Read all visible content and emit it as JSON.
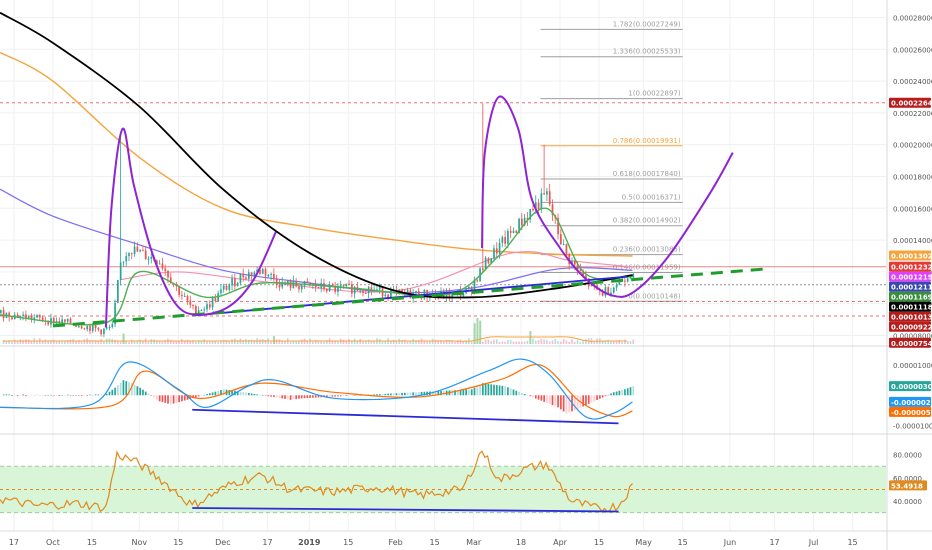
{
  "chart_data": {
    "type": "line",
    "colors": {
      "up": "#26a69a",
      "down": "#ef5350",
      "black_ma": "#000000",
      "orange_ma": "#f4a43c",
      "blue_ma": "#7b6ef6",
      "green_ma": "#4caf50",
      "pink_ma": "#f48fb1",
      "pattern": "#8e24d4",
      "trend": "#2a2ad8",
      "dashed_trend": "#1f9d2c",
      "rsi": "#e08a1e",
      "rsi_band": "#d9f5d8",
      "macd_line": "#2196f3",
      "signal_line": "#ff6d00",
      "level_red": "#e53935",
      "fib": "#9e9e9e",
      "fib_orange": "#f4a43c"
    },
    "x_axis": {
      "range": [
        "2018-09-12",
        "2019-07-27"
      ],
      "ticks": [
        {
          "label": "17",
          "date": "2018-09-17"
        },
        {
          "label": "Oct",
          "date": "2018-10-01"
        },
        {
          "label": "15",
          "date": "2018-10-15"
        },
        {
          "label": "Nov",
          "date": "2018-11-01"
        },
        {
          "label": "15",
          "date": "2018-11-15"
        },
        {
          "label": "Dec",
          "date": "2018-12-01"
        },
        {
          "label": "17",
          "date": "2018-12-17"
        },
        {
          "label": "2019",
          "date": "2019-01-01"
        },
        {
          "label": "15",
          "date": "2019-01-15"
        },
        {
          "label": "Feb",
          "date": "2019-02-01"
        },
        {
          "label": "15",
          "date": "2019-02-15"
        },
        {
          "label": "Mar",
          "date": "2019-03-01"
        },
        {
          "label": "18",
          "date": "2019-03-18"
        },
        {
          "label": "Apr",
          "date": "2019-04-01"
        },
        {
          "label": "15",
          "date": "2019-04-15"
        },
        {
          "label": "May",
          "date": "2019-05-01"
        },
        {
          "label": "15",
          "date": "2019-05-15"
        },
        {
          "label": "Jun",
          "date": "2019-06-01"
        },
        {
          "label": "17",
          "date": "2019-06-17"
        },
        {
          "label": "Jul",
          "date": "2019-07-01"
        },
        {
          "label": "15",
          "date": "2019-07-15"
        }
      ]
    },
    "price_pane": {
      "ylim": [
        7.4e-05,
        0.000291
      ],
      "y_ticks": [
        "0.00028000",
        "0.00026000",
        "0.00024000",
        "0.00022000",
        "0.00020000",
        "0.00018000",
        "0.00016000",
        "0.00014000",
        "0.00012000",
        "0.00010000",
        "0.00008000"
      ],
      "tick_values": [
        0.00028,
        0.00026,
        0.00024,
        0.00022,
        0.0002,
        0.00018,
        0.00016,
        0.00014,
        0.00012,
        0.0001,
        8e-05
      ],
      "badges": [
        {
          "text": "0.00022641",
          "bg": "#b71c1c",
          "value": 0.00022641
        },
        {
          "text": "0.00013029",
          "bg": "#f4a43c",
          "value": 0.00013029
        },
        {
          "text": "0.00012324",
          "bg": "#e53935",
          "value": 0.00012324
        },
        {
          "text": "0.00012198",
          "bg": "#e040fb",
          "value": 0.00012198
        },
        {
          "text": "0.00012113",
          "bg": "#3949ab",
          "value": 0.00012113
        },
        {
          "text": "0.00011693",
          "bg": "#388e3c",
          "value": 0.00011693
        },
        {
          "text": "0.00011188",
          "bg": "#000000",
          "value": 0.00011188
        },
        {
          "text": "0.00010136",
          "bg": "#b71c1c",
          "value": 0.00010136
        },
        {
          "text": "0.00009225",
          "bg": "#b71c1c",
          "value": 9.225e-05
        },
        {
          "text": "0.00007541",
          "bg": "#b71c1c",
          "value": 7.541e-05
        }
      ],
      "fib_levels": [
        {
          "label": "1.782(0.00027249)",
          "value": 0.00027249
        },
        {
          "label": "1.336(0.00025533)",
          "value": 0.00025533
        },
        {
          "label": "1(0.00022897)",
          "value": 0.00022897
        },
        {
          "label": "0.786(0.00019931)",
          "value": 0.00019931
        },
        {
          "label": "0.618(0.00017840)",
          "value": 0.0001784
        },
        {
          "label": "0.5(0.00016371)",
          "value": 0.00016371
        },
        {
          "label": "0.382(0.00014902)",
          "value": 0.00014902
        },
        {
          "label": "0.236(0.00013085)",
          "value": 0.00013085
        },
        {
          "label": "0.146(0.00011959)",
          "value": 0.00011959
        },
        {
          "label": "0(0.00010148)",
          "value": 0.00010148
        }
      ],
      "fib_range": [
        "2019-03-25",
        "2019-05-15"
      ],
      "red_dashed_levels": [
        0.00022641,
        0.00010136,
        9.225e-05
      ],
      "red_level": 0.00012324,
      "price_points": [
        [
          "2018-09-12",
          9.4e-05
        ],
        [
          "2018-09-20",
          9.2e-05
        ],
        [
          "2018-10-01",
          8.9e-05
        ],
        [
          "2018-10-10",
          8.7e-05
        ],
        [
          "2018-10-18",
          8.3e-05
        ],
        [
          "2018-10-22",
          8.5e-05
        ],
        [
          "2018-10-25",
          0.000125
        ],
        [
          "2018-10-28",
          0.000135
        ],
        [
          "2018-11-02",
          0.000131
        ],
        [
          "2018-11-08",
          0.000127
        ],
        [
          "2018-11-14",
          0.00011
        ],
        [
          "2018-11-20",
          9.6e-05
        ],
        [
          "2018-11-25",
          9.8e-05
        ],
        [
          "2018-12-01",
          0.000109
        ],
        [
          "2018-12-08",
          0.000118
        ],
        [
          "2018-12-15",
          0.000121
        ],
        [
          "2018-12-22",
          0.000112
        ],
        [
          "2019-01-01",
          0.000111
        ],
        [
          "2019-01-10",
          0.000109
        ],
        [
          "2019-01-20",
          0.00011
        ],
        [
          "2019-02-01",
          0.000106
        ],
        [
          "2019-02-10",
          0.000106
        ],
        [
          "2019-02-20",
          0.000105
        ],
        [
          "2019-02-27",
          0.000108
        ],
        [
          "2019-03-02",
          0.000117
        ],
        [
          "2019-03-06",
          0.000128
        ],
        [
          "2019-03-12",
          0.00014
        ],
        [
          "2019-03-18",
          0.000152
        ],
        [
          "2019-03-22",
          0.00016
        ],
        [
          "2019-03-27",
          0.000168
        ],
        [
          "2019-03-30",
          0.00015
        ],
        [
          "2019-04-03",
          0.00013
        ],
        [
          "2019-04-08",
          0.000119
        ],
        [
          "2019-04-12",
          0.00011
        ],
        [
          "2019-04-16",
          0.000107
        ],
        [
          "2019-04-20",
          0.000111
        ],
        [
          "2019-04-24",
          0.000117
        ],
        [
          "2019-04-27",
          0.000121
        ]
      ],
      "spikes": [
        {
          "date": "2018-10-25",
          "high": 0.000205
        },
        {
          "date": "2019-03-04",
          "high": 0.000226
        },
        {
          "date": "2019-03-26",
          "high": 0.0002
        }
      ],
      "black_ma": [
        [
          "2018-09-12",
          0.000283
        ],
        [
          "2018-10-01",
          0.000264
        ],
        [
          "2018-11-01",
          0.000224
        ],
        [
          "2018-12-01",
          0.000172
        ],
        [
          "2019-01-01",
          0.000132
        ],
        [
          "2019-02-01",
          0.000108
        ],
        [
          "2019-03-01",
          0.000104
        ],
        [
          "2019-04-01",
          0.00011
        ],
        [
          "2019-04-27",
          0.000118
        ]
      ],
      "orange_ma": [
        [
          "2018-09-12",
          0.000258
        ],
        [
          "2018-10-01",
          0.00024
        ],
        [
          "2018-11-01",
          0.000192
        ],
        [
          "2018-12-01",
          0.00016
        ],
        [
          "2019-01-01",
          0.000148
        ],
        [
          "2019-02-01",
          0.00014
        ],
        [
          "2019-03-01",
          0.000134
        ],
        [
          "2019-04-01",
          0.000131
        ],
        [
          "2019-04-27",
          0.00013
        ]
      ],
      "blue_ma": [
        [
          "2018-09-12",
          0.000172
        ],
        [
          "2018-10-01",
          0.000155
        ],
        [
          "2018-11-01",
          0.000137
        ],
        [
          "2018-12-01",
          0.000121
        ],
        [
          "2019-01-01",
          0.000113
        ],
        [
          "2019-02-01",
          0.000107
        ],
        [
          "2019-03-01",
          0.00011
        ],
        [
          "2019-04-01",
          0.000122
        ],
        [
          "2019-04-27",
          0.000121
        ]
      ],
      "green_ma": [
        [
          "2018-09-12",
          9.3e-05
        ],
        [
          "2018-10-20",
          8.8e-05
        ],
        [
          "2018-11-01",
          0.00012
        ],
        [
          "2018-11-25",
          0.000104
        ],
        [
          "2018-12-15",
          0.000113
        ],
        [
          "2019-01-15",
          0.00011
        ],
        [
          "2019-02-20",
          0.000106
        ],
        [
          "2019-03-10",
          0.00013
        ],
        [
          "2019-03-27",
          0.00016
        ],
        [
          "2019-04-10",
          0.000119
        ],
        [
          "2019-04-27",
          0.000117
        ]
      ],
      "pink_ma": [
        [
          "2018-10-25",
          0.000115
        ],
        [
          "2018-11-15",
          0.00012
        ],
        [
          "2018-12-15",
          0.000114
        ],
        [
          "2019-02-01",
          0.000108
        ],
        [
          "2019-03-15",
          0.000132
        ],
        [
          "2019-04-05",
          0.000127
        ],
        [
          "2019-04-27",
          0.000123
        ]
      ],
      "support_line": [
        [
          "2018-11-20",
          9.25e-05
        ],
        [
          "2019-04-25",
          0.000117
        ]
      ],
      "dashed_support": [
        [
          "2018-10-01",
          8.6e-05
        ],
        [
          "2019-06-15",
          0.000122
        ]
      ],
      "volume_bars": [
        {
          "date": "2018-10-26",
          "height": 0.4
        },
        {
          "date": "2018-12-19",
          "height": 0.3
        },
        {
          "date": "2019-03-01",
          "height": 0.8
        },
        {
          "date": "2019-03-02",
          "height": 1.0
        },
        {
          "date": "2019-03-03",
          "height": 0.9
        },
        {
          "date": "2019-03-21",
          "height": 0.5
        }
      ]
    },
    "macd_pane": {
      "ylim": [
        -1.25e-05,
        1.6e-05
      ],
      "y_ticks": [
        "0.00001000",
        "-0.00001000"
      ],
      "tick_values": [
        1e-05,
        -1e-05
      ],
      "badges": [
        {
          "text": "0.00000303",
          "bg": "#26a69a",
          "value": 3.03e-06
        },
        {
          "text": "-0.00000217",
          "bg": "#2196f3",
          "value": -2.17e-06
        },
        {
          "text": "-0.00000520",
          "bg": "#ff6d00",
          "value": -5.2e-06
        }
      ],
      "trend_line": [
        [
          "2018-11-20",
          -4.8e-06
        ],
        [
          "2019-04-22",
          -9.3e-06
        ]
      ],
      "macd_points": [
        [
          "2018-09-12",
          -4e-06
        ],
        [
          "2018-10-15",
          -3e-06
        ],
        [
          "2018-10-28",
          1.1e-05
        ],
        [
          "2018-11-15",
          2e-06
        ],
        [
          "2018-11-25",
          -4e-06
        ],
        [
          "2018-12-10",
          3e-06
        ],
        [
          "2018-12-20",
          5e-06
        ],
        [
          "2019-01-10",
          -1e-06
        ],
        [
          "2019-02-10",
          0.0
        ],
        [
          "2019-03-06",
          8e-06
        ],
        [
          "2019-03-18",
          1.2e-05
        ],
        [
          "2019-03-28",
          7e-06
        ],
        [
          "2019-04-10",
          -7e-06
        ],
        [
          "2019-04-20",
          -6e-06
        ],
        [
          "2019-04-27",
          -2.2e-06
        ]
      ],
      "signal_points": [
        [
          "2018-09-12",
          -4e-06
        ],
        [
          "2018-10-22",
          -3.5e-06
        ],
        [
          "2018-11-03",
          8e-06
        ],
        [
          "2018-11-22",
          -1e-06
        ],
        [
          "2018-12-15",
          4e-06
        ],
        [
          "2019-01-10",
          1e-06
        ],
        [
          "2019-02-10",
          -5e-07
        ],
        [
          "2019-03-10",
          5e-06
        ],
        [
          "2019-03-25",
          1e-05
        ],
        [
          "2019-04-08",
          -2e-06
        ],
        [
          "2019-04-20",
          -7e-06
        ],
        [
          "2019-04-27",
          -5.2e-06
        ]
      ],
      "histogram": [
        [
          "2018-10-20",
          5e-07
        ],
        [
          "2018-10-23",
          2.5e-06
        ],
        [
          "2018-10-26",
          5e-06
        ],
        [
          "2018-10-29",
          4e-06
        ],
        [
          "2018-11-01",
          2.5e-06
        ],
        [
          "2018-11-08",
          -2e-06
        ],
        [
          "2018-11-12",
          -3e-06
        ],
        [
          "2018-11-16",
          -2e-06
        ],
        [
          "2018-12-01",
          2e-06
        ],
        [
          "2018-12-05",
          1.5e-06
        ],
        [
          "2018-12-25",
          -1.5e-06
        ],
        [
          "2018-12-29",
          -1e-06
        ],
        [
          "2019-02-28",
          2e-06
        ],
        [
          "2019-03-04",
          4e-06
        ],
        [
          "2019-03-08",
          3.5e-06
        ],
        [
          "2019-03-12",
          3e-06
        ],
        [
          "2019-03-31",
          -4e-06
        ],
        [
          "2019-04-03",
          -6e-06
        ],
        [
          "2019-04-06",
          -5e-06
        ],
        [
          "2019-04-20",
          1e-06
        ],
        [
          "2019-04-24",
          2e-06
        ],
        [
          "2019-04-27",
          3e-06
        ]
      ]
    },
    "rsi_pane": {
      "ylim": [
        15,
        97
      ],
      "y_ticks": [
        "80.0000",
        "60.0000",
        "40.0000"
      ],
      "tick_values": [
        80,
        60,
        40
      ],
      "band": [
        30,
        70
      ],
      "midline": 50,
      "badge": {
        "text": "53.4918",
        "bg": "#e08a1e",
        "value": 53.4918
      },
      "trend_line": [
        [
          "2018-11-20",
          34
        ],
        [
          "2019-04-22",
          31
        ]
      ],
      "rsi_points": [
        [
          "2018-09-12",
          42
        ],
        [
          "2018-09-25",
          36
        ],
        [
          "2018-10-10",
          38
        ],
        [
          "2018-10-20",
          34
        ],
        [
          "2018-10-24",
          80
        ],
        [
          "2018-10-30",
          75
        ],
        [
          "2018-11-08",
          60
        ],
        [
          "2018-11-20",
          36
        ],
        [
          "2018-12-05",
          56
        ],
        [
          "2018-12-15",
          62
        ],
        [
          "2018-12-25",
          50
        ],
        [
          "2019-01-10",
          48
        ],
        [
          "2019-01-25",
          52
        ],
        [
          "2019-02-10",
          45
        ],
        [
          "2019-02-25",
          50
        ],
        [
          "2019-03-04",
          84
        ],
        [
          "2019-03-10",
          58
        ],
        [
          "2019-03-20",
          68
        ],
        [
          "2019-03-27",
          72
        ],
        [
          "2019-04-05",
          40
        ],
        [
          "2019-04-15",
          33
        ],
        [
          "2019-04-22",
          36
        ],
        [
          "2019-04-27",
          53.5
        ]
      ]
    }
  }
}
